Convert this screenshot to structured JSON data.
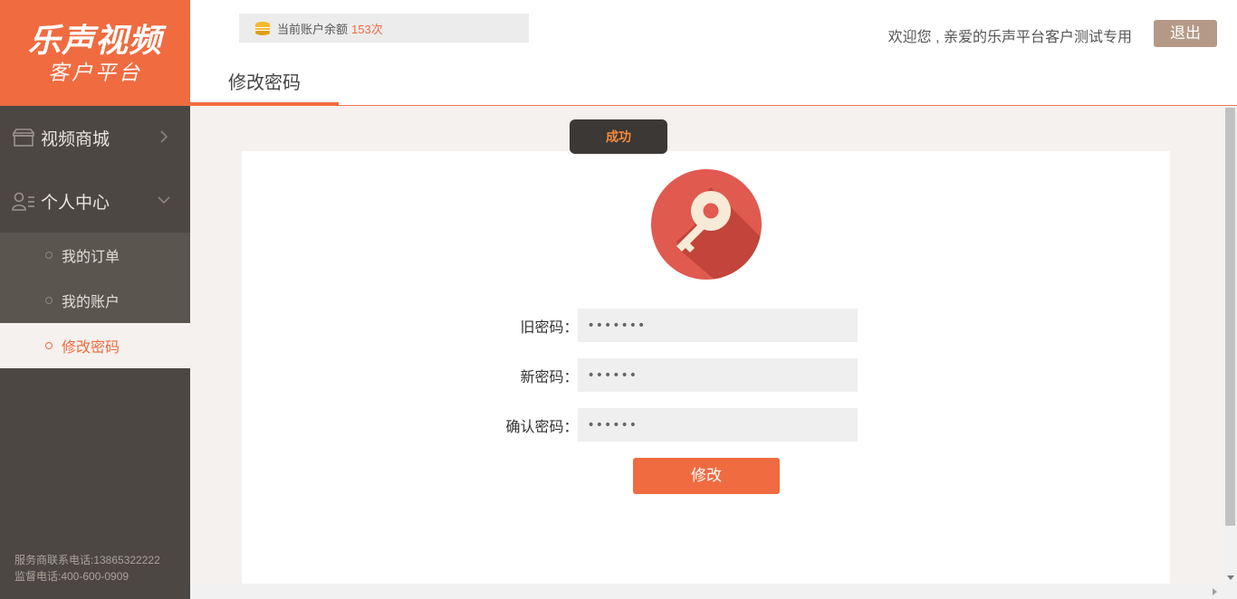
{
  "logo": {
    "title": "乐声视频",
    "subtitle": "客户平台"
  },
  "sidebar": {
    "groups": [
      {
        "label": "视频商城",
        "icon": "store-icon",
        "chevron": "chevron-right-icon"
      },
      {
        "label": "个人中心",
        "icon": "user-list-icon",
        "chevron": "chevron-down-icon"
      }
    ],
    "subitems": [
      {
        "label": "我的订单"
      },
      {
        "label": "我的账户"
      },
      {
        "label": "修改密码",
        "active": true
      }
    ],
    "footer": {
      "service_phone": "服务商联系电话:13865322222",
      "supervise_phone": "监督电话:400-600-0909"
    }
  },
  "header": {
    "balance_label": "当前账户余额",
    "balance_count": "153次",
    "welcome": "欢迎您 , 亲爱的乐声平台客户测试专用",
    "logout_label": "退出",
    "tab_label": "修改密码"
  },
  "toast": {
    "text": "成功"
  },
  "form": {
    "old_password": {
      "label": "旧密码：",
      "value": "•••••••"
    },
    "new_password": {
      "label": "新密码：",
      "value": "••••••"
    },
    "confirm_password": {
      "label": "确认密码：",
      "value": "••••••"
    },
    "submit_label": "修改"
  },
  "colors": {
    "accent": "#f06b40",
    "sidebar": "#4c4742",
    "toast_bg": "#3b3835",
    "logout_bg": "#b49a86",
    "key_circle": "#e05a4f"
  }
}
